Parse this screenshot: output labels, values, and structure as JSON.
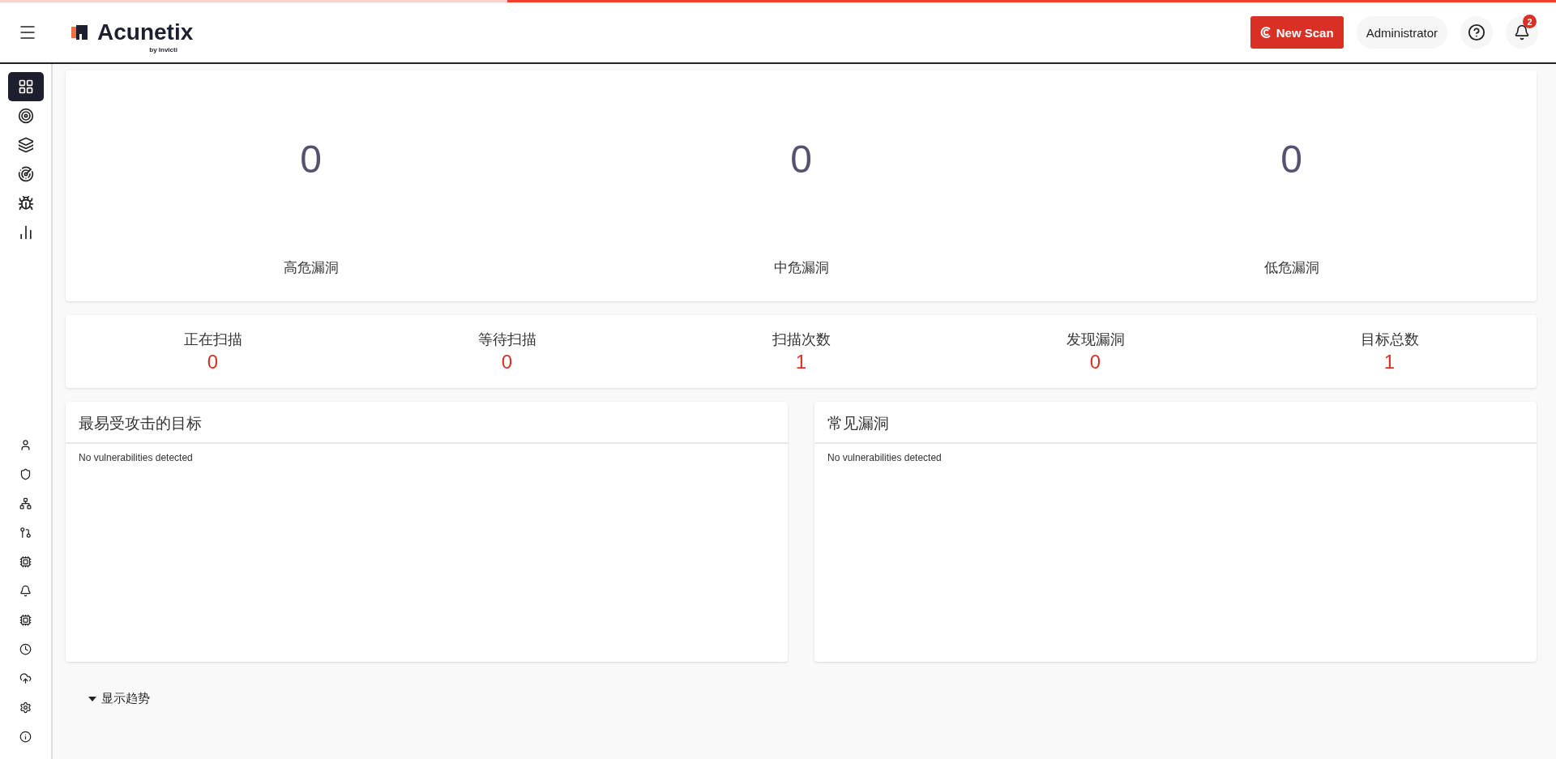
{
  "loading_bar": {
    "level": 0.674
  },
  "header": {
    "logo": "Acunetix",
    "logo_subtitle": "by Invicti",
    "new_scan": "New Scan",
    "user": "Administrator",
    "notifications": "2"
  },
  "sidebar": {
    "items": [
      {
        "selected": true
      },
      {
        "selected": false
      },
      {
        "selected": false
      },
      {
        "selected": false
      },
      {
        "selected": false
      },
      {
        "selected": false
      }
    ],
    "bottom_items": [
      {
        "selected": false
      },
      {
        "selected": false
      },
      {
        "selected": false
      },
      {
        "selected": false
      },
      {
        "selected": false
      },
      {
        "selected": false
      },
      {
        "selected": false
      },
      {
        "selected": false
      },
      {
        "selected": false
      },
      {
        "selected": false
      },
      {
        "selected": false
      }
    ]
  },
  "severity": [
    {
      "count": "0",
      "label": "高危漏洞"
    },
    {
      "count": "0",
      "label": "中危漏洞"
    },
    {
      "count": "0",
      "label": "低危漏洞"
    }
  ],
  "stats": [
    {
      "label": "正在扫描",
      "value": "0"
    },
    {
      "label": "等待扫描",
      "value": "0"
    },
    {
      "label": "扫描次数",
      "value": "1"
    },
    {
      "label": "发现漏洞",
      "value": "0"
    },
    {
      "label": "目标总数",
      "value": "1"
    }
  ],
  "panels": [
    {
      "title": "最易受攻击的目标",
      "message": "No vulnerabilities detected"
    },
    {
      "title": "常见漏洞",
      "message": "No vulnerabilities detected"
    }
  ],
  "trends_toggle": {
    "label": "显示趋势",
    "expanded": false
  }
}
